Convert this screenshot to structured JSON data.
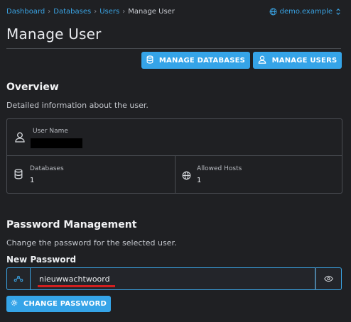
{
  "breadcrumb": {
    "items": [
      "Dashboard",
      "Databases",
      "Users"
    ],
    "current": "Manage User"
  },
  "domain_switch": {
    "label": "demo.example",
    "icon": "globe-icon",
    "chevron": "chevron-updown-icon"
  },
  "page_title": "Manage User",
  "toolbar": {
    "manage_databases": "MANAGE DATABASES",
    "manage_users": "MANAGE USERS"
  },
  "overview": {
    "title": "Overview",
    "description": "Detailed information about the user.",
    "user_name_label": "User Name",
    "user_name_value": "",
    "databases_label": "Databases",
    "databases_value": "1",
    "allowed_hosts_label": "Allowed Hosts",
    "allowed_hosts_value": "1"
  },
  "password": {
    "title": "Password Management",
    "description": "Change the password for the selected user.",
    "field_label": "New Password",
    "value": "nieuwwachtwoord",
    "change_button": "CHANGE PASSWORD"
  },
  "colors": {
    "accent": "#35a4e8",
    "background": "#1f2023",
    "annotation": "#d21f1f"
  }
}
